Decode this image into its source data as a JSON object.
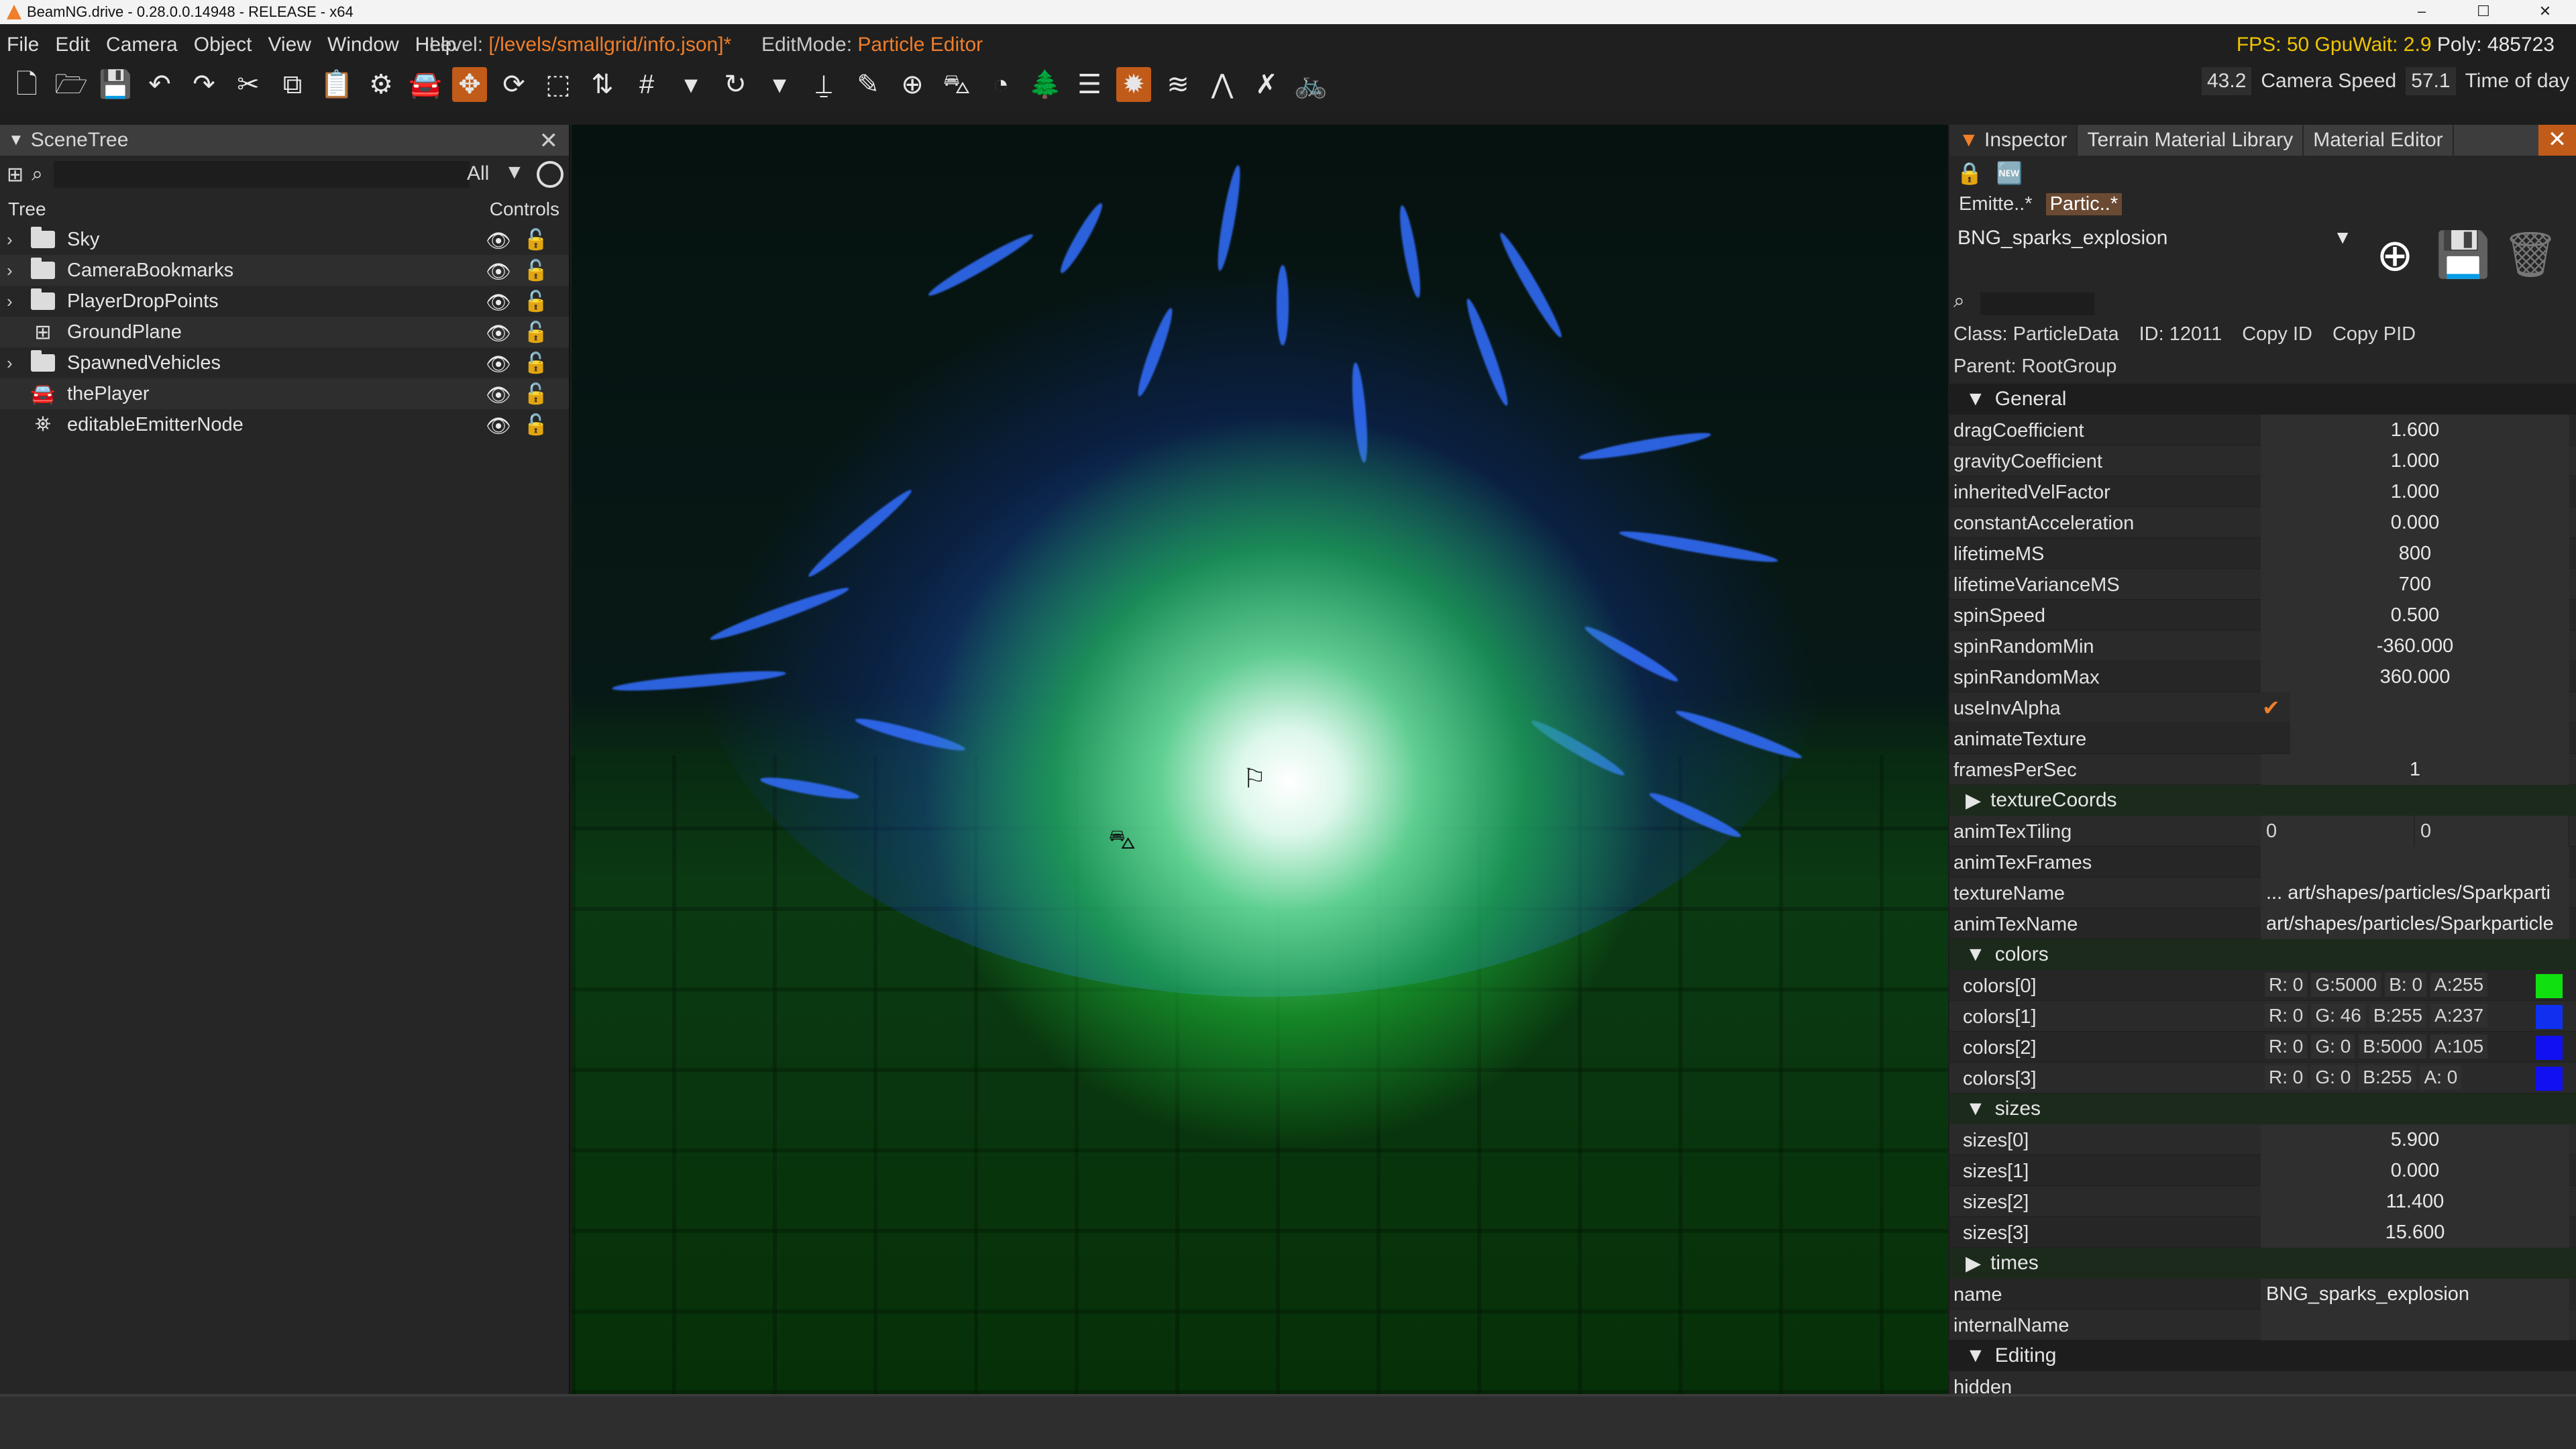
{
  "window": {
    "title": "BeamNG.drive - 0.28.0.0.14948 - RELEASE - x64",
    "buttons": [
      "–",
      "☐",
      "✕"
    ]
  },
  "menubar": {
    "items": [
      "File",
      "Edit",
      "Camera",
      "Object",
      "View",
      "Window",
      "Help"
    ],
    "level_label": "Level:",
    "level_path": "[/levels/smallgrid/info.json]*",
    "editmode_label": "EditMode:",
    "editmode_value": "Particle Editor",
    "fps_label": "FPS: 50 GpuWait: 2.9",
    "poly": "Poly: 485723"
  },
  "toolbar": {
    "tools": [
      "new-file",
      "open",
      "save",
      "undo",
      "redo",
      "cut",
      "copy",
      "paste",
      "settings",
      "vehicle",
      "move",
      "rotate",
      "scale",
      "snap",
      "grid",
      "dropdown",
      "rotate-snap",
      "dropdown2",
      "stamp",
      "pencil",
      "add",
      "road",
      "water",
      "forest",
      "layers",
      "particle",
      "river",
      "decal",
      "walkable",
      "bike"
    ],
    "camera_speed_value": "43.2",
    "camera_speed_label": "Camera Speed",
    "time_value": "57.1",
    "time_label": "Time of day"
  },
  "scenetree": {
    "title": "SceneTree",
    "filter_all": "All",
    "col_tree": "Tree",
    "col_controls": "Controls",
    "rows": [
      {
        "label": "Sky",
        "type": "folder",
        "expandable": true
      },
      {
        "label": "CameraBookmarks",
        "type": "folder",
        "expandable": true
      },
      {
        "label": "PlayerDropPoints",
        "type": "folder",
        "expandable": true
      },
      {
        "label": "GroundPlane",
        "type": "grid",
        "expandable": false
      },
      {
        "label": "SpawnedVehicles",
        "type": "folder",
        "expandable": true
      },
      {
        "label": "thePlayer",
        "type": "car",
        "expandable": false
      },
      {
        "label": "editableEmitterNode",
        "type": "emitter",
        "expandable": false
      }
    ]
  },
  "inspector": {
    "tabs": [
      "Inspector",
      "Terrain Material Library",
      "Material Editor"
    ],
    "subtabs": [
      "Emitte..*",
      "Partic..*"
    ],
    "selected": "BNG_sparks_explosion",
    "class_text": "Class: ParticleData",
    "id_text": "ID: 12011",
    "copy_id": "Copy ID",
    "copy_pid": "Copy PID",
    "parent_text": "Parent: RootGroup",
    "general_title": "General",
    "general": [
      {
        "k": "dragCoefficient",
        "v": "1.600"
      },
      {
        "k": "gravityCoefficient",
        "v": "1.000"
      },
      {
        "k": "inheritedVelFactor",
        "v": "1.000"
      },
      {
        "k": "constantAcceleration",
        "v": "0.000"
      },
      {
        "k": "lifetimeMS",
        "v": "800"
      },
      {
        "k": "lifetimeVarianceMS",
        "v": "700"
      },
      {
        "k": "spinSpeed",
        "v": "0.500"
      },
      {
        "k": "spinRandomMin",
        "v": "-360.000"
      },
      {
        "k": "spinRandomMax",
        "v": "360.000"
      },
      {
        "k": "useInvAlpha",
        "v": "✔"
      },
      {
        "k": "animateTexture",
        "v": ""
      },
      {
        "k": "framesPerSec",
        "v": "1"
      }
    ],
    "texcoords_title": "textureCoords",
    "anim_tex_tiling": {
      "k": "animTexTiling",
      "a": "0",
      "b": "0"
    },
    "anim_tex_frames": "animTexFrames",
    "texture_name": {
      "k": "textureName",
      "v": "... art/shapes/particles/Sparkparti"
    },
    "anim_tex_name": {
      "k": "animTexName",
      "v": "art/shapes/particles/Sparkparticle"
    },
    "colors_title": "colors",
    "colors": [
      {
        "k": "colors[0]",
        "r": "R: 0",
        "g": "G:5000",
        "b": "B: 0",
        "a": "A:255",
        "swatch": "#10e010"
      },
      {
        "k": "colors[1]",
        "r": "R: 0",
        "g": "G: 46",
        "b": "B:255",
        "a": "A:237",
        "swatch": "#1030f0"
      },
      {
        "k": "colors[2]",
        "r": "R: 0",
        "g": "G: 0",
        "b": "B:5000",
        "a": "A:105",
        "swatch": "#1010f0"
      },
      {
        "k": "colors[3]",
        "r": "R: 0",
        "g": "G: 0",
        "b": "B:255",
        "a": "A: 0",
        "swatch": "#1010f0"
      }
    ],
    "sizes_title": "sizes",
    "sizes": [
      {
        "k": "sizes[0]",
        "v": "5.900"
      },
      {
        "k": "sizes[1]",
        "v": "0.000"
      },
      {
        "k": "sizes[2]",
        "v": "11.400"
      },
      {
        "k": "sizes[3]",
        "v": "15.600"
      }
    ],
    "times_title": "times",
    "name_row": {
      "k": "name",
      "v": "BNG_sparks_explosion"
    },
    "internal_name": "internalName",
    "editing_title": "Editing",
    "hidden": "hidden"
  },
  "colors": {
    "accent": "#f07e2a",
    "fps_yellow": "#f0c400"
  }
}
